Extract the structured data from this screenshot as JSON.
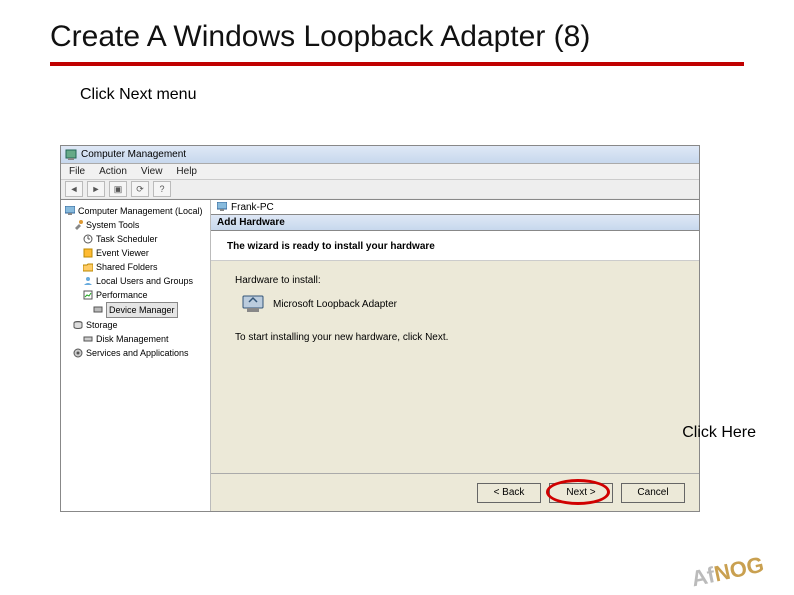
{
  "slide": {
    "title": "Create A Windows Loopback Adapter (8)",
    "instruction": "Click Next menu",
    "click_here_label": "Click Here"
  },
  "mgmt_window": {
    "title": "Computer Management"
  },
  "menu": {
    "file": "File",
    "action": "Action",
    "view": "View",
    "help": "Help"
  },
  "tree": {
    "root": "Computer Management (Local)",
    "system_tools": "System Tools",
    "task_scheduler": "Task Scheduler",
    "event_viewer": "Event Viewer",
    "shared_folders": "Shared Folders",
    "local_users": "Local Users and Groups",
    "performance": "Performance",
    "device_manager": "Device Manager",
    "storage": "Storage",
    "disk_management": "Disk Management",
    "services_apps": "Services and Applications"
  },
  "right_panel": {
    "pc_name": "Frank-PC"
  },
  "wizard": {
    "dialog_title": "Add Hardware",
    "header": "The wizard is ready to install your hardware",
    "hardware_label": "Hardware to install:",
    "hardware_name": "Microsoft Loopback Adapter",
    "start_text": "To start installing your new hardware, click Next.",
    "back": "< Back",
    "next": "Next >",
    "cancel": "Cancel"
  },
  "logo": {
    "af": "Af",
    "nog": "NOG"
  }
}
